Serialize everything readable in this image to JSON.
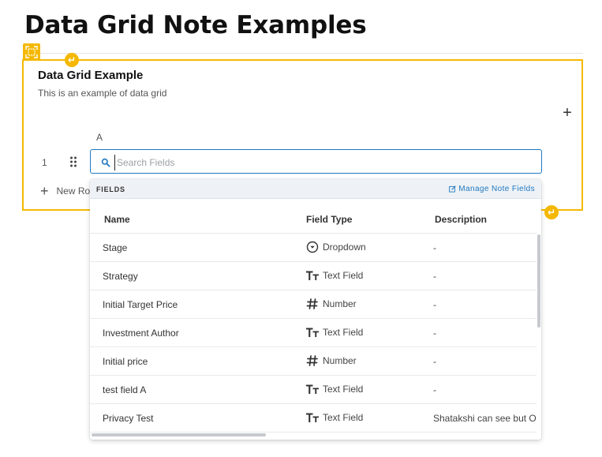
{
  "page": {
    "title": "Data Grid Note Examples"
  },
  "card": {
    "title": "Data Grid Example",
    "description": "This is an example of data grid",
    "add_column_label": "+",
    "column_header": "A",
    "row_number": "1",
    "new_row_label": "New Ro"
  },
  "search": {
    "placeholder": "Search Fields",
    "value": ""
  },
  "dropdown": {
    "section_label": "FIELDS",
    "manage_label": "Manage Note Fields",
    "columns": {
      "name": "Name",
      "type": "Field Type",
      "description": "Description"
    },
    "rows": [
      {
        "name": "Stage",
        "type": "Dropdown",
        "icon": "dropdown-icon",
        "description": "-"
      },
      {
        "name": "Strategy",
        "type": "Text Field",
        "icon": "text-field-icon",
        "description": "-"
      },
      {
        "name": "Initial Target Price",
        "type": "Number",
        "icon": "number-icon",
        "description": "-"
      },
      {
        "name": "Investment Author",
        "type": "Text Field",
        "icon": "text-field-icon",
        "description": "-"
      },
      {
        "name": "Initial price",
        "type": "Number",
        "icon": "number-icon",
        "description": "-"
      },
      {
        "name": "test field A",
        "type": "Text Field",
        "icon": "text-field-icon",
        "description": "-"
      },
      {
        "name": "Privacy Test",
        "type": "Text Field",
        "icon": "text-field-icon",
        "description": "Shatakshi can see but O"
      }
    ]
  },
  "colors": {
    "accent": "#f5b800",
    "link": "#1f78c1",
    "header_bg": "#eef2f6"
  }
}
